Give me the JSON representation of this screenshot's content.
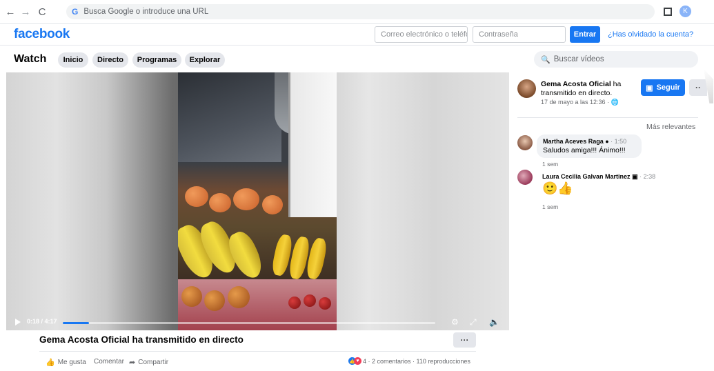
{
  "browser": {
    "address_placeholder": "Busca Google o introduce una URL",
    "profile_initial": "K"
  },
  "fb": {
    "logo": "facebook",
    "email_placeholder": "Correo electrónico o teléfono",
    "password_placeholder": "Contraseña",
    "login_label": "Entrar",
    "forgot_label": "¿Has olvidado la cuenta?"
  },
  "watch": {
    "title": "Watch",
    "tabs": [
      {
        "label": "Inicio"
      },
      {
        "label": "Directo"
      },
      {
        "label": "Programas"
      },
      {
        "label": "Explorar"
      }
    ],
    "search_placeholder": "Buscar vídeos"
  },
  "video": {
    "time": "0:18 / 4:17",
    "progress": 0.07
  },
  "post": {
    "title": "Gema Acosta Oficial ha transmitido en directo",
    "more_label": "···",
    "actions": {
      "like": "Me gusta",
      "comment": "Comentar",
      "share": "Compartir"
    },
    "stats": "4 · 2 comentarios · 110 reproducciones"
  },
  "author": {
    "name": "Gema Acosta Oficial",
    "status": " ha transmitido en directo.",
    "date": "17 de mayo a las 12:36 · ",
    "follow_label": "Seguir",
    "more_label": "··"
  },
  "comments": {
    "sort_label": "Más relevantes",
    "items": [
      {
        "name": "Martha Aceves Raga",
        "meta": " · 1:50",
        "text": "Saludos amiga!!! Ánimo!!!",
        "age": "1 sem"
      },
      {
        "name": "Laura Cecilia Galvan Martinez",
        "meta": " · 2:38",
        "text": "🙂👍",
        "age": "1 sem"
      }
    ]
  },
  "colors": {
    "brand": "#1877f2",
    "pill_bg": "#e4e6eb",
    "muted_text": "#65676b"
  }
}
